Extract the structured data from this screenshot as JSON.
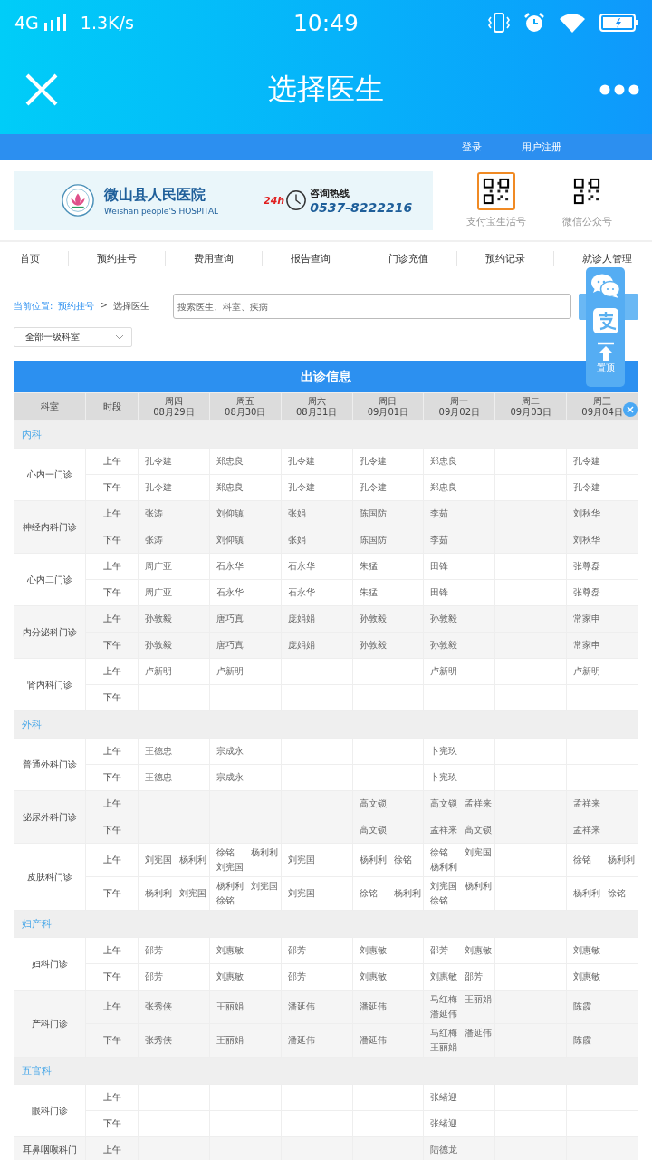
{
  "status_bar": {
    "network": "4G",
    "speed": "1.3K/s",
    "time": "10:49"
  },
  "title_bar": {
    "title": "选择医生"
  },
  "top_links": [
    "登录",
    "用户注册"
  ],
  "banner": {
    "name_zh": "微山县人民医院",
    "name_en": "Weishan people'S HOSPITAL",
    "badge": "24h",
    "hotline_label": "咨询热线",
    "hotline_number": "0537-8222216"
  },
  "qr_codes": [
    {
      "label": "支付宝生活号",
      "kind": "alipay"
    },
    {
      "label": "微信公众号",
      "kind": "wechat"
    }
  ],
  "nav": [
    "首页",
    "预约挂号",
    "费用查询",
    "报告查询",
    "门诊充值",
    "预约记录",
    "就诊人管理"
  ],
  "breadcrumb": {
    "label": "当前位置:",
    "link": "预约挂号",
    "separator": ">",
    "current": "选择医生"
  },
  "search": {
    "placeholder": "搜索医生、科室、疾病"
  },
  "filter": {
    "value": "全部一级科室"
  },
  "schedule": {
    "title": "出诊信息",
    "headers": [
      "科室",
      "时段"
    ],
    "days": [
      {
        "day": "周四",
        "date": "08月29日"
      },
      {
        "day": "周五",
        "date": "08月30日"
      },
      {
        "day": "周六",
        "date": "08月31日"
      },
      {
        "day": "周日",
        "date": "09月01日"
      },
      {
        "day": "周一",
        "date": "09月02日"
      },
      {
        "day": "周二",
        "date": "09月03日"
      },
      {
        "day": "周三",
        "date": "09月04日"
      }
    ],
    "categories": [
      {
        "name": "内科",
        "departments": [
          {
            "name": "心内一门诊",
            "rows": [
              {
                "period": "上午",
                "cells": [
                  [
                    "孔令建"
                  ],
                  [
                    "郑忠良"
                  ],
                  [
                    "孔令建"
                  ],
                  [
                    "孔令建"
                  ],
                  [
                    "郑忠良"
                  ],
                  [],
                  [
                    "孔令建"
                  ]
                ]
              },
              {
                "period": "下午",
                "cells": [
                  [
                    "孔令建"
                  ],
                  [
                    "郑忠良"
                  ],
                  [
                    "孔令建"
                  ],
                  [
                    "孔令建"
                  ],
                  [
                    "郑忠良"
                  ],
                  [],
                  [
                    "孔令建"
                  ]
                ]
              }
            ]
          },
          {
            "name": "神经内科门诊",
            "rows": [
              {
                "period": "上午",
                "cells": [
                  [
                    "张涛"
                  ],
                  [
                    "刘仰镇"
                  ],
                  [
                    "张娟"
                  ],
                  [
                    "陈国防"
                  ],
                  [
                    "李茹"
                  ],
                  [],
                  [
                    "刘秋华"
                  ]
                ]
              },
              {
                "period": "下午",
                "cells": [
                  [
                    "张涛"
                  ],
                  [
                    "刘仰镇"
                  ],
                  [
                    "张娟"
                  ],
                  [
                    "陈国防"
                  ],
                  [
                    "李茹"
                  ],
                  [],
                  [
                    "刘秋华"
                  ]
                ]
              }
            ]
          },
          {
            "name": "心内二门诊",
            "rows": [
              {
                "period": "上午",
                "cells": [
                  [
                    "周广亚"
                  ],
                  [
                    "石永华"
                  ],
                  [
                    "石永华"
                  ],
                  [
                    "朱猛"
                  ],
                  [
                    "田锋"
                  ],
                  [],
                  [
                    "张尊磊"
                  ]
                ]
              },
              {
                "period": "下午",
                "cells": [
                  [
                    "周广亚"
                  ],
                  [
                    "石永华"
                  ],
                  [
                    "石永华"
                  ],
                  [
                    "朱猛"
                  ],
                  [
                    "田锋"
                  ],
                  [],
                  [
                    "张尊磊"
                  ]
                ]
              }
            ]
          },
          {
            "name": "内分泌科门诊",
            "rows": [
              {
                "period": "上午",
                "cells": [
                  [
                    "孙敦毅"
                  ],
                  [
                    "唐巧真"
                  ],
                  [
                    "庞娟娟"
                  ],
                  [
                    "孙敦毅"
                  ],
                  [
                    "孙敦毅"
                  ],
                  [],
                  [
                    "常家申"
                  ]
                ]
              },
              {
                "period": "下午",
                "cells": [
                  [
                    "孙敦毅"
                  ],
                  [
                    "唐巧真"
                  ],
                  [
                    "庞娟娟"
                  ],
                  [
                    "孙敦毅"
                  ],
                  [
                    "孙敦毅"
                  ],
                  [],
                  [
                    "常家申"
                  ]
                ]
              }
            ]
          },
          {
            "name": "肾内科门诊",
            "rows": [
              {
                "period": "上午",
                "cells": [
                  [
                    "卢新明"
                  ],
                  [
                    "卢新明"
                  ],
                  [],
                  [],
                  [
                    "卢新明"
                  ],
                  [],
                  [
                    "卢新明"
                  ]
                ]
              },
              {
                "period": "下午",
                "cells": [
                  [],
                  [],
                  [],
                  [],
                  [],
                  [],
                  []
                ]
              }
            ]
          }
        ]
      },
      {
        "name": "外科",
        "departments": [
          {
            "name": "普通外科门诊",
            "rows": [
              {
                "period": "上午",
                "cells": [
                  [
                    "王德忠"
                  ],
                  [
                    "宗成永"
                  ],
                  [],
                  [],
                  [
                    "卜宪玖"
                  ],
                  [],
                  []
                ]
              },
              {
                "period": "下午",
                "cells": [
                  [
                    "王德忠"
                  ],
                  [
                    "宗成永"
                  ],
                  [],
                  [],
                  [
                    "卜宪玖"
                  ],
                  [],
                  []
                ]
              }
            ]
          },
          {
            "name": "泌尿外科门诊",
            "rows": [
              {
                "period": "上午",
                "cells": [
                  [],
                  [],
                  [],
                  [
                    "高文锁"
                  ],
                  [
                    "高文锁",
                    "孟祥来"
                  ],
                  [],
                  [
                    "孟祥来"
                  ]
                ]
              },
              {
                "period": "下午",
                "cells": [
                  [],
                  [],
                  [],
                  [
                    "高文锁"
                  ],
                  [
                    "孟祥来",
                    "高文锁"
                  ],
                  [],
                  [
                    "孟祥来"
                  ]
                ]
              }
            ]
          },
          {
            "name": "皮肤科门诊",
            "rows": [
              {
                "period": "上午",
                "cells": [
                  [
                    "刘宪国",
                    "杨利利"
                  ],
                  [
                    "徐铭",
                    "杨利利",
                    "刘宪国"
                  ],
                  [
                    "刘宪国"
                  ],
                  [
                    "杨利利",
                    "徐铭"
                  ],
                  [
                    "徐铭",
                    "刘宪国",
                    "杨利利"
                  ],
                  [],
                  [
                    "徐铭",
                    "杨利利"
                  ]
                ]
              },
              {
                "period": "下午",
                "cells": [
                  [
                    "杨利利",
                    "刘宪国"
                  ],
                  [
                    "杨利利",
                    "刘宪国",
                    "徐铭"
                  ],
                  [
                    "刘宪国"
                  ],
                  [
                    "徐铭",
                    "杨利利"
                  ],
                  [
                    "刘宪国",
                    "杨利利",
                    "徐铭"
                  ],
                  [],
                  [
                    "杨利利",
                    "徐铭"
                  ]
                ]
              }
            ]
          }
        ]
      },
      {
        "name": "妇产科",
        "departments": [
          {
            "name": "妇科门诊",
            "rows": [
              {
                "period": "上午",
                "cells": [
                  [
                    "邵芳"
                  ],
                  [
                    "刘惠敏"
                  ],
                  [
                    "邵芳"
                  ],
                  [
                    "刘惠敏"
                  ],
                  [
                    "邵芳",
                    "刘惠敏"
                  ],
                  [],
                  [
                    "刘惠敏"
                  ]
                ]
              },
              {
                "period": "下午",
                "cells": [
                  [
                    "邵芳"
                  ],
                  [
                    "刘惠敏"
                  ],
                  [
                    "邵芳"
                  ],
                  [
                    "刘惠敏"
                  ],
                  [
                    "刘惠敏",
                    "邵芳"
                  ],
                  [],
                  [
                    "刘惠敏"
                  ]
                ]
              }
            ]
          },
          {
            "name": "产科门诊",
            "rows": [
              {
                "period": "上午",
                "cells": [
                  [
                    "张秀侠"
                  ],
                  [
                    "王丽娟"
                  ],
                  [
                    "潘延伟"
                  ],
                  [
                    "潘延伟"
                  ],
                  [
                    "马红梅",
                    "王丽娟",
                    "潘延伟"
                  ],
                  [],
                  [
                    "陈霞"
                  ]
                ]
              },
              {
                "period": "下午",
                "cells": [
                  [
                    "张秀侠"
                  ],
                  [
                    "王丽娟"
                  ],
                  [
                    "潘延伟"
                  ],
                  [
                    "潘延伟"
                  ],
                  [
                    "马红梅",
                    "潘延伟",
                    "王丽娟"
                  ],
                  [],
                  [
                    "陈霞"
                  ]
                ]
              }
            ]
          }
        ]
      },
      {
        "name": "五官科",
        "departments": [
          {
            "name": "眼科门诊",
            "rows": [
              {
                "period": "上午",
                "cells": [
                  [],
                  [],
                  [],
                  [],
                  [
                    "张绪迎"
                  ],
                  [],
                  []
                ]
              },
              {
                "period": "下午",
                "cells": [
                  [],
                  [],
                  [],
                  [],
                  [
                    "张绪迎"
                  ],
                  [],
                  []
                ]
              }
            ]
          },
          {
            "name": "耳鼻咽喉科门",
            "rows": [
              {
                "period": "上午",
                "cells": [
                  [],
                  [],
                  [],
                  [],
                  [
                    "陆德龙"
                  ],
                  [],
                  []
                ]
              }
            ]
          }
        ]
      }
    ]
  },
  "float_panel": {
    "top_label": "置顶"
  }
}
